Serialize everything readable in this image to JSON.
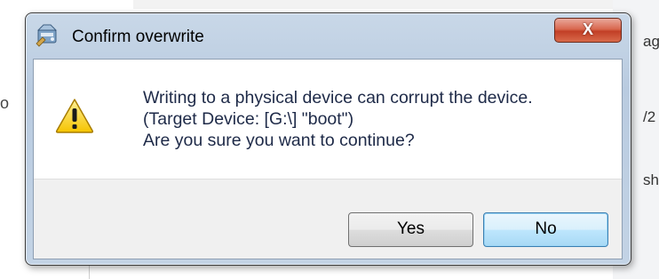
{
  "background": {
    "left_fragment": "o",
    "right_fragments": [
      "ag",
      "/2",
      "sh"
    ]
  },
  "dialog": {
    "title": "Confirm overwrite",
    "close_label": "X",
    "message_lines": [
      "Writing to a physical device can corrupt the device.",
      "(Target Device: [G:\\] \"boot\")",
      "Are you sure you want to continue?"
    ],
    "buttons": {
      "yes_label": "Yes",
      "no_label": "No"
    },
    "icons": {
      "title": "disk-imager-icon",
      "message": "warning-icon"
    }
  },
  "colors": {
    "title_frame": "#c3d3e5",
    "close_button": "#c23f26",
    "default_button_border": "#3c7fb1",
    "message_text": "#1e2a48",
    "warning_fill": "#f5c400"
  }
}
